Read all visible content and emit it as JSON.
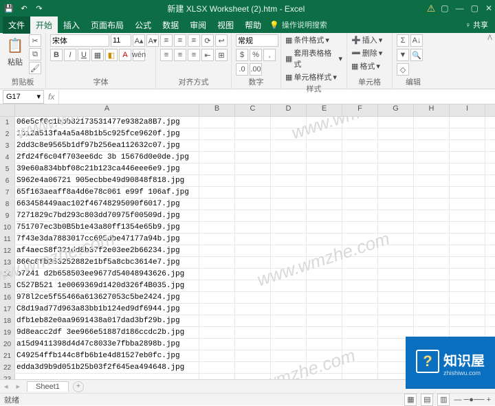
{
  "titlebar": {
    "title": "新建 XLSX Worksheet (2).htm  -  Excel",
    "min": "—",
    "max": "▢",
    "close": "✕"
  },
  "tabs": {
    "file": "文件",
    "home": "开始",
    "insert": "插入",
    "layout": "页面布局",
    "formula": "公式",
    "data": "数据",
    "review": "审阅",
    "view": "视图",
    "help": "帮助",
    "tell": "操作说明搜索",
    "share": "共享"
  },
  "ribbon": {
    "clipboard": {
      "label": "剪贴板",
      "paste": "粘贴"
    },
    "font": {
      "label": "字体",
      "name": "宋体",
      "size": "11"
    },
    "align": {
      "label": "对齐方式"
    },
    "number": {
      "label": "数字",
      "format": "常规"
    },
    "styles": {
      "label": "样式",
      "cond": "条件格式",
      "table": "套用表格格式",
      "cell": "单元格样式"
    },
    "cells": {
      "label": "单元格",
      "ins": "插入",
      "del": "删除",
      "fmt": "格式"
    },
    "editing": {
      "label": "编辑"
    }
  },
  "namebox": "G17",
  "columns": [
    "A",
    "B",
    "C",
    "D",
    "E",
    "F",
    "G",
    "H",
    "I"
  ],
  "rows": [
    "06e5cf0c1bbb82173531477e9382a8B7.jpg",
    "1b12a513fa4a5a48b1b5c925fce9620f.jpg",
    "2dd3c8e9565b1df97b256ea112632c07.jpg",
    "2fd24f6c04f703ee6dc 3b 15676d0e0de.jpg",
    "39e60a834bbf08c21b123ca446eee6e9.jpg",
    "S962e4a06721 905ecbbe49d90848f818.jpg",
    "65f163aeaff8a4d6e78c061 e99f 106af.jpg",
    "663458449aac102f46748295090f6017.jpg",
    "7271829c7bd293c803dd70975f00509d.jpg",
    "751707ec3b0B5b1e43a80ff1354e65b9.jpg",
    "7f43e3da7883017cc695dbe47177a94b.jpg",
    "af4aecS8f321dd8b37f2e03ee2b66234.jpg",
    "866c8fb353252882e1bf5a8cbc3614e7.jpg",
    "b7241 d2b658503ee9677d54048943626.jpg",
    "C527B521 1e0069369d1420d326f4B035.jpg",
    " 978l2ce5f55466a613627053c5be2424.jpg",
    "C8d19ad77d963a83bb1b124ed9df6944.jpg",
    "dfb1eb82e0aa9691438a017dad3bf29b.jpg",
    "9d8eacc2df 3ee966e51887d186ccdc2b.jpg",
    "a15d9411398d4d47c8033e7fbba2898b.jpg",
    "C49254ffb144c8fb6b1e4d81527eb0fc.jpg",
    "edda3d9b9d051b25b03f2f645ea494648.jpg"
  ],
  "sheet": {
    "name": "Sheet1",
    "plus": "+"
  },
  "status": {
    "ready": "就绪",
    "zoom": "+"
  },
  "logo": {
    "name": "知识屋",
    "url": "zhishiwu.com"
  },
  "watermark": "www.wmzhe.com"
}
